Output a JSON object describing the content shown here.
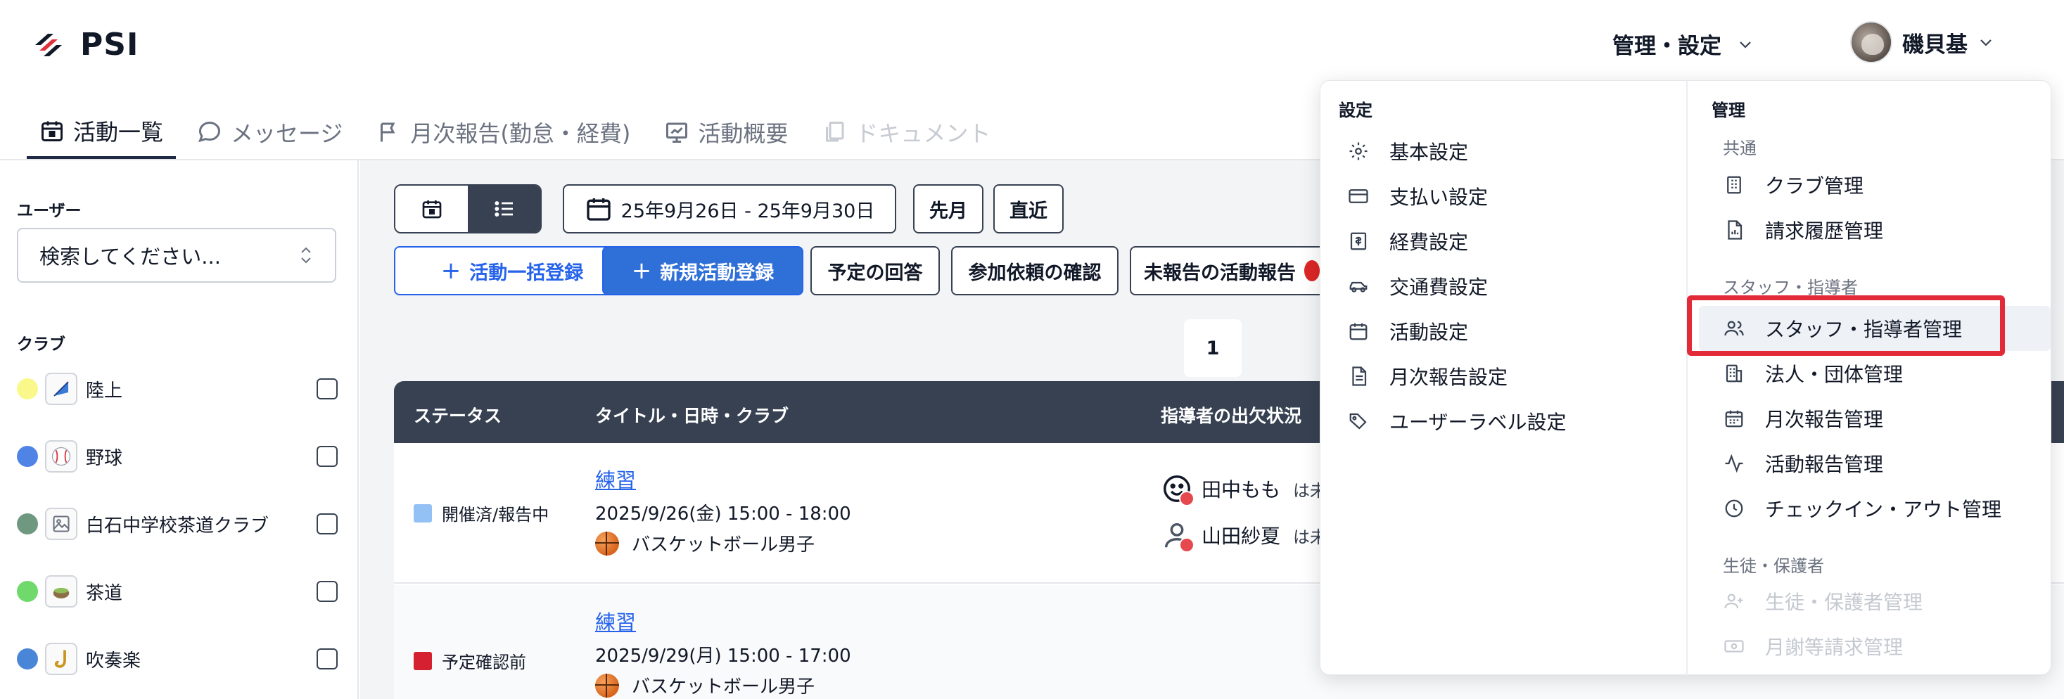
{
  "app": {
    "name": "PSI"
  },
  "header": {
    "admin_menu_label": "管理・設定",
    "user_name": "磯貝基"
  },
  "tabs": [
    {
      "label": "活動一覧",
      "icon": "calendar-icon",
      "state": "active"
    },
    {
      "label": "メッセージ",
      "icon": "chat-icon",
      "state": "normal"
    },
    {
      "label": "月次報告(勤怠・経費)",
      "icon": "flag-icon",
      "state": "normal"
    },
    {
      "label": "活動概要",
      "icon": "chart-icon",
      "state": "normal"
    },
    {
      "label": "ドキュメント",
      "icon": "document-icon",
      "state": "disabled"
    }
  ],
  "sidebar": {
    "user_label": "ユーザー",
    "user_select_placeholder": "検索してください...",
    "club_label": "クラブ",
    "clubs": [
      {
        "name": "陸上",
        "color": "#faf88a",
        "icon": "flag-icon"
      },
      {
        "name": "野球",
        "color": "#4f83e6",
        "icon": "baseball-icon"
      },
      {
        "name": "白石中学校茶道クラブ",
        "color": "#6f9880",
        "icon": "image-icon"
      },
      {
        "name": "茶道",
        "color": "#6fd96b",
        "icon": "tea-icon"
      },
      {
        "name": "吹奏楽",
        "color": "#4a86d8",
        "icon": "saxophone-icon"
      }
    ]
  },
  "toolbar": {
    "date_range": "25年9月26日 - 25年9月30日",
    "prev_month": "先月",
    "recent": "直近",
    "bulk_register": "活動一括登録",
    "new_activity": "新規活動登録",
    "schedule_answer": "予定の回答",
    "participation_check": "参加依頼の確認",
    "unreported": "未報告の活動報告"
  },
  "pagination": {
    "current_page": "1"
  },
  "table": {
    "headers": {
      "status": "ステータス",
      "title": "タイトル・日時・クラブ",
      "instructor": "指導者の出欠状況"
    },
    "rows": [
      {
        "status": "開催済/報告中",
        "status_color": "#93c0f5",
        "title": "練習",
        "datetime": "2025/9/26(金) 15:00 - 18:00",
        "club": "バスケットボール男子",
        "instructors": [
          {
            "name": "田中もも",
            "note": "は未"
          },
          {
            "name": "山田紗夏",
            "note": "は未"
          }
        ]
      },
      {
        "status": "予定確認前",
        "status_color": "#d42030",
        "title": "練習",
        "datetime": "2025/9/29(月) 15:00 - 17:00",
        "club": "バスケットボール男子",
        "instructors": []
      }
    ]
  },
  "dropdown": {
    "settings_head": "設定",
    "settings_items": [
      {
        "label": "基本設定",
        "icon": "gear-icon"
      },
      {
        "label": "支払い設定",
        "icon": "credit-card-icon"
      },
      {
        "label": "経費設定",
        "icon": "receipt-icon"
      },
      {
        "label": "交通費設定",
        "icon": "car-icon"
      },
      {
        "label": "活動設定",
        "icon": "calendar-icon"
      },
      {
        "label": "月次報告設定",
        "icon": "file-icon"
      },
      {
        "label": "ユーザーラベル設定",
        "icon": "tags-icon"
      }
    ],
    "admin_head": "管理",
    "common_head": "共通",
    "common_items": [
      {
        "label": "クラブ管理",
        "icon": "building-icon"
      },
      {
        "label": "請求履歴管理",
        "icon": "invoice-icon"
      }
    ],
    "staff_head": "スタッフ・指導者",
    "staff_items": [
      {
        "label": "スタッフ・指導者管理",
        "icon": "users-icon",
        "highlighted": true
      },
      {
        "label": "法人・団体管理",
        "icon": "organization-icon"
      },
      {
        "label": "月次報告管理",
        "icon": "calendar-icon"
      },
      {
        "label": "活動報告管理",
        "icon": "activity-icon"
      },
      {
        "label": "チェックイン・アウト管理",
        "icon": "clock-icon"
      }
    ],
    "student_head": "生徒・保護者",
    "student_items": [
      {
        "label": "生徒・保護者管理",
        "icon": "user-plus-icon",
        "disabled": true
      },
      {
        "label": "月謝等請求管理",
        "icon": "money-icon",
        "disabled": true
      }
    ]
  }
}
